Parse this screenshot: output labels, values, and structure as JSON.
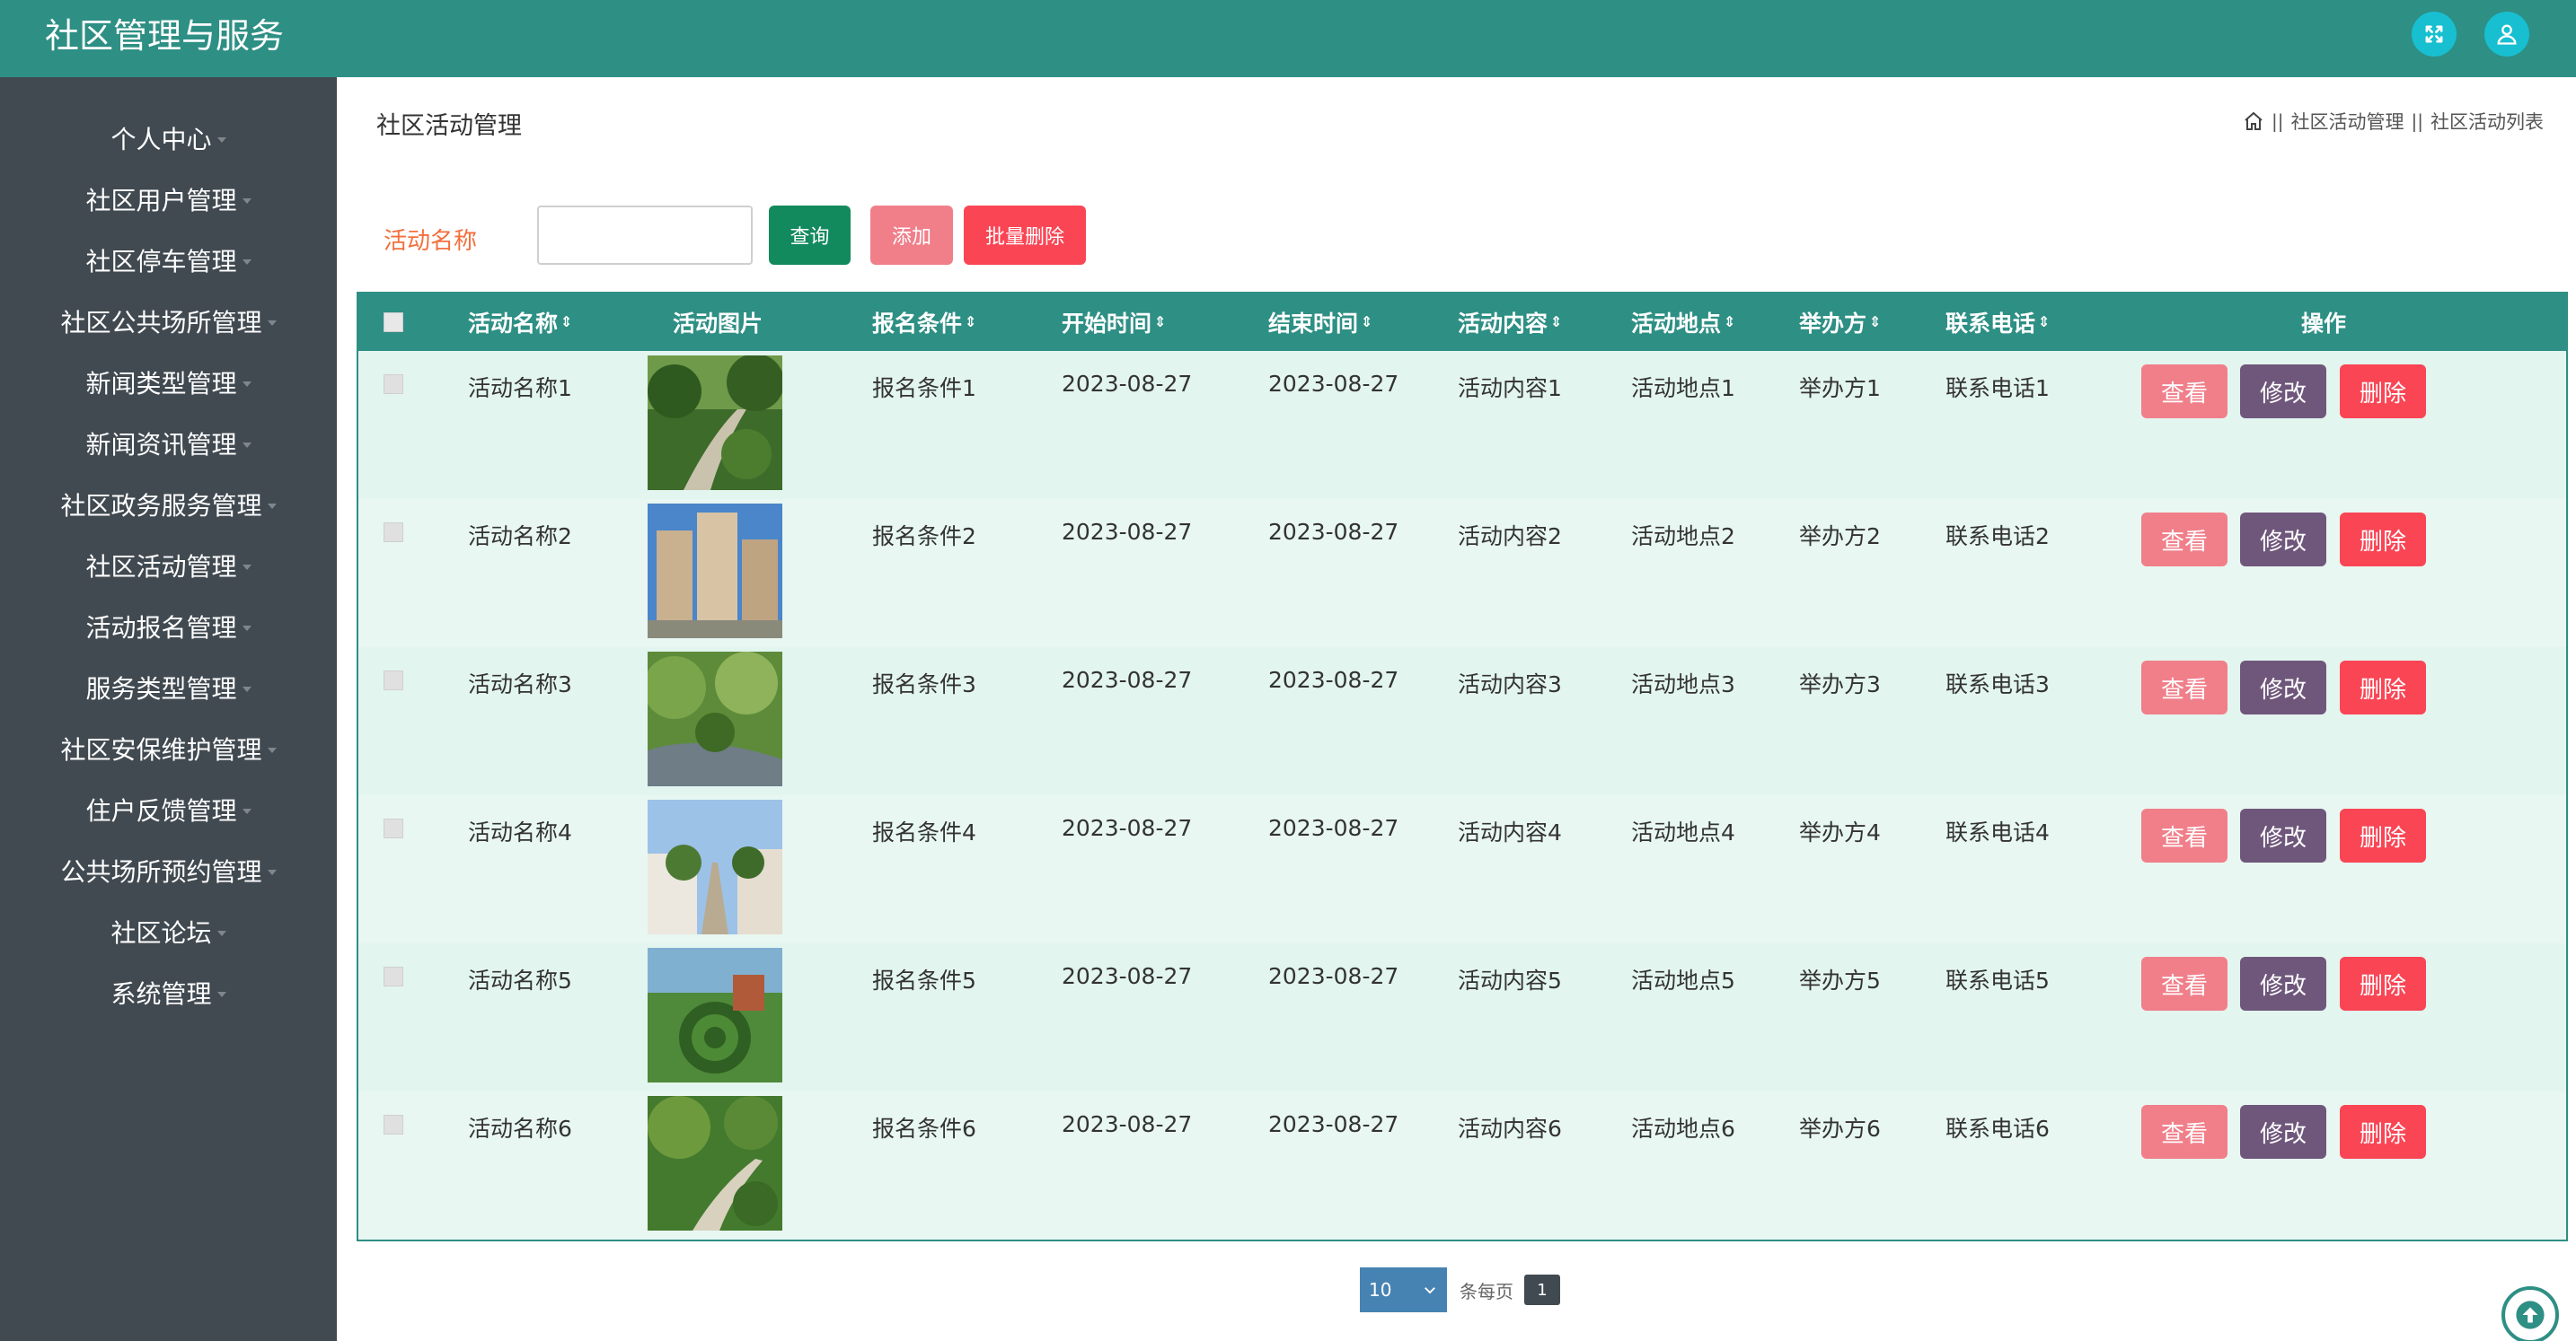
{
  "app": {
    "title": "社区管理与服务"
  },
  "header": {
    "fullscreen_icon": "fullscreen-icon",
    "user_icon": "user-icon"
  },
  "sidebar": {
    "items": [
      {
        "label": "个人中心"
      },
      {
        "label": "社区用户管理"
      },
      {
        "label": "社区停车管理"
      },
      {
        "label": "社区公共场所管理"
      },
      {
        "label": "新闻类型管理"
      },
      {
        "label": "新闻资讯管理"
      },
      {
        "label": "社区政务服务管理"
      },
      {
        "label": "社区活动管理"
      },
      {
        "label": "活动报名管理"
      },
      {
        "label": "服务类型管理"
      },
      {
        "label": "社区安保维护管理"
      },
      {
        "label": "住户反馈管理"
      },
      {
        "label": "公共场所预约管理"
      },
      {
        "label": "社区论坛"
      },
      {
        "label": "系统管理"
      }
    ]
  },
  "page": {
    "title": "社区活动管理",
    "breadcrumb": {
      "sep1": "||",
      "item1": "社区活动管理",
      "sep2": "||",
      "item2": "社区活动列表"
    }
  },
  "search": {
    "label": "活动名称",
    "value": "",
    "query_label": "查询",
    "add_label": "添加",
    "batch_delete_label": "批量删除"
  },
  "table": {
    "headers": {
      "name": "活动名称",
      "image": "活动图片",
      "condition": "报名条件",
      "start": "开始时间",
      "end": "结束时间",
      "content": "活动内容",
      "location": "活动地点",
      "organizer": "举办方",
      "phone": "联系电话",
      "ops": "操作"
    },
    "actions": {
      "view": "查看",
      "edit": "修改",
      "delete": "删除"
    },
    "rows": [
      {
        "name": "活动名称1",
        "condition": "报名条件1",
        "start": "2023-08-27",
        "end": "2023-08-27",
        "content": "活动内容1",
        "location": "活动地点1",
        "organizer": "举办方1",
        "phone": "联系电话1"
      },
      {
        "name": "活动名称2",
        "condition": "报名条件2",
        "start": "2023-08-27",
        "end": "2023-08-27",
        "content": "活动内容2",
        "location": "活动地点2",
        "organizer": "举办方2",
        "phone": "联系电话2"
      },
      {
        "name": "活动名称3",
        "condition": "报名条件3",
        "start": "2023-08-27",
        "end": "2023-08-27",
        "content": "活动内容3",
        "location": "活动地点3",
        "organizer": "举办方3",
        "phone": "联系电话3"
      },
      {
        "name": "活动名称4",
        "condition": "报名条件4",
        "start": "2023-08-27",
        "end": "2023-08-27",
        "content": "活动内容4",
        "location": "活动地点4",
        "organizer": "举办方4",
        "phone": "联系电话4"
      },
      {
        "name": "活动名称5",
        "condition": "报名条件5",
        "start": "2023-08-27",
        "end": "2023-08-27",
        "content": "活动内容5",
        "location": "活动地点5",
        "organizer": "举办方5",
        "phone": "联系电话5"
      },
      {
        "name": "活动名称6",
        "condition": "报名条件6",
        "start": "2023-08-27",
        "end": "2023-08-27",
        "content": "活动内容6",
        "location": "活动地点6",
        "organizer": "举办方6",
        "phone": "联系电话6"
      }
    ]
  },
  "pagination": {
    "page_size": "10",
    "per_page_label": "条每页",
    "current_page": "1"
  },
  "colors": {
    "header_bg": "#2e8f84",
    "sidebar_bg": "#414a51",
    "query": "#138a5d",
    "add": "#f07f8a",
    "batch_delete": "#fa4554",
    "edit": "#6f577b"
  }
}
